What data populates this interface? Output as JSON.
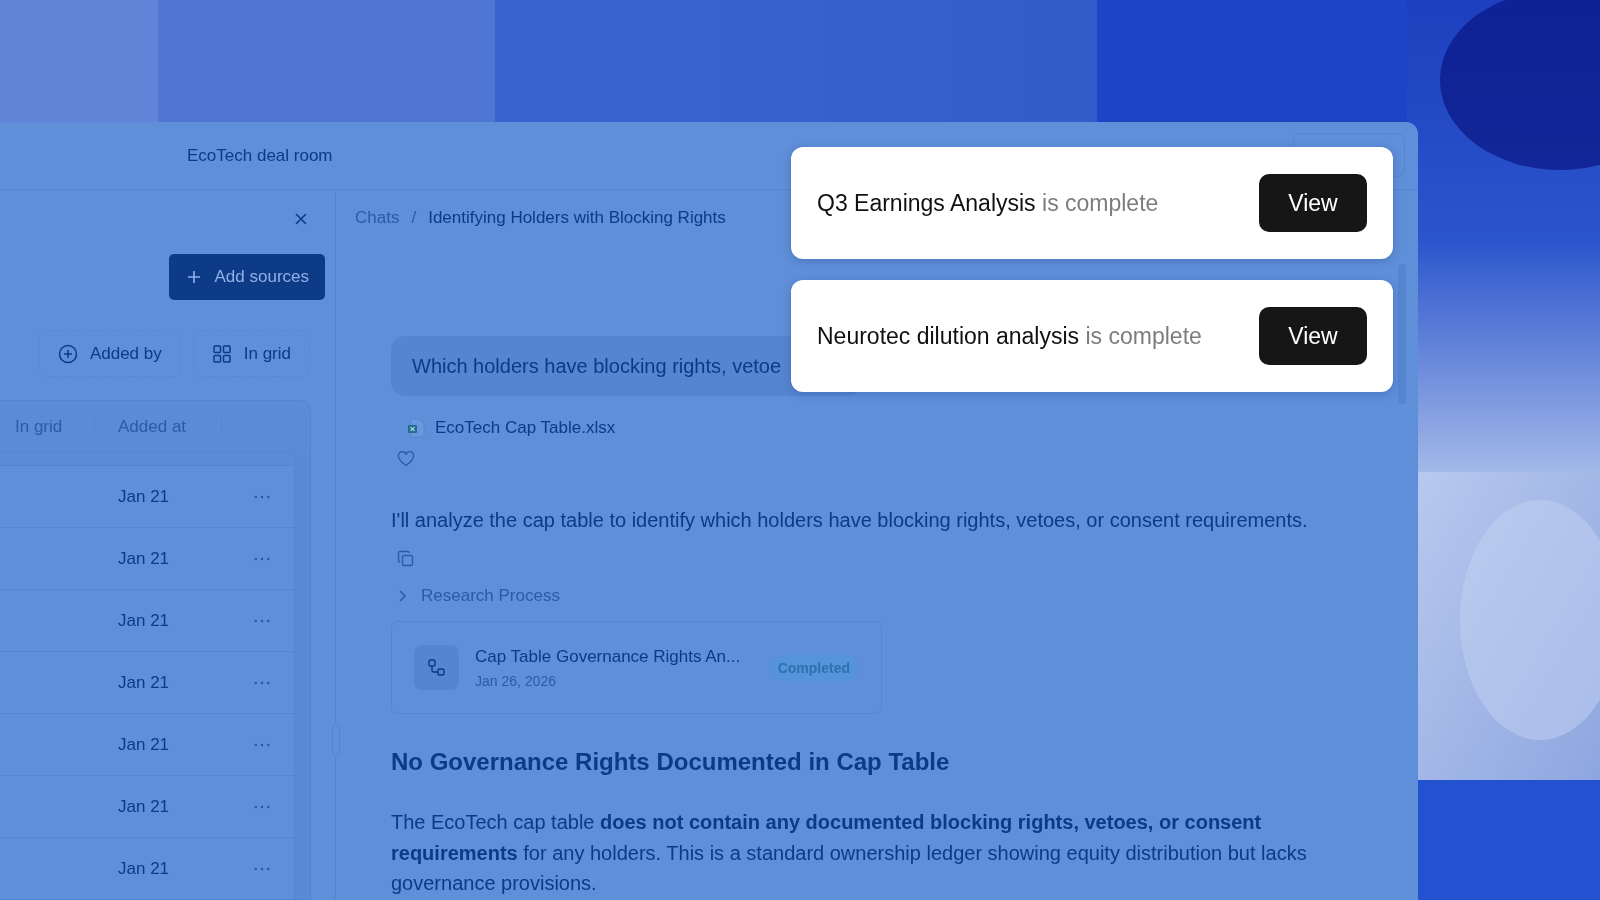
{
  "window": {
    "title": "EcoTech deal room"
  },
  "sidebar": {
    "add_button": "Add sources",
    "filters": [
      {
        "label": "Added by",
        "kind": "add"
      },
      {
        "label": "In grid",
        "kind": "grid"
      }
    ],
    "table": {
      "columns": [
        "In grid",
        "Added at"
      ],
      "rows": [
        {
          "added_at": "Jan 21"
        },
        {
          "added_at": "Jan 21"
        },
        {
          "added_at": "Jan 21"
        },
        {
          "added_at": "Jan 21"
        },
        {
          "added_at": "Jan 21"
        },
        {
          "added_at": "Jan 21"
        },
        {
          "added_at": "Jan 21"
        }
      ]
    }
  },
  "breadcrumb": {
    "separator": "/",
    "items": [
      "Chats",
      "Identifying Holders with Blocking Rights"
    ]
  },
  "chat": {
    "query": "Which holders have blocking rights, vetoe",
    "attachment": "EcoTech Cap Table.xlsx",
    "reply": "I'll analyze the cap table to identify which holders have blocking rights, vetoes, or consent requirements.",
    "process": {
      "label": "Research Process",
      "expanded": false
    },
    "task": {
      "title": "Cap Table Governance Rights An...",
      "date": "Jan 26, 2026",
      "status": "Completed"
    },
    "heading": "No Governance Rights Documented in Cap Table",
    "body": "The EcoTech cap table **does not contain any documented blocking rights, vetoes, or consent requirements** for any holders. This is a standard ownership ledger showing equity distribution but lacks governance provisions."
  },
  "toasts": [
    {
      "subject": "Q3 Earnings Analysis",
      "suffix": "is complete",
      "action": "View"
    },
    {
      "subject": "Neurotec dilution analysis",
      "suffix": "is complete",
      "action": "View"
    }
  ]
}
